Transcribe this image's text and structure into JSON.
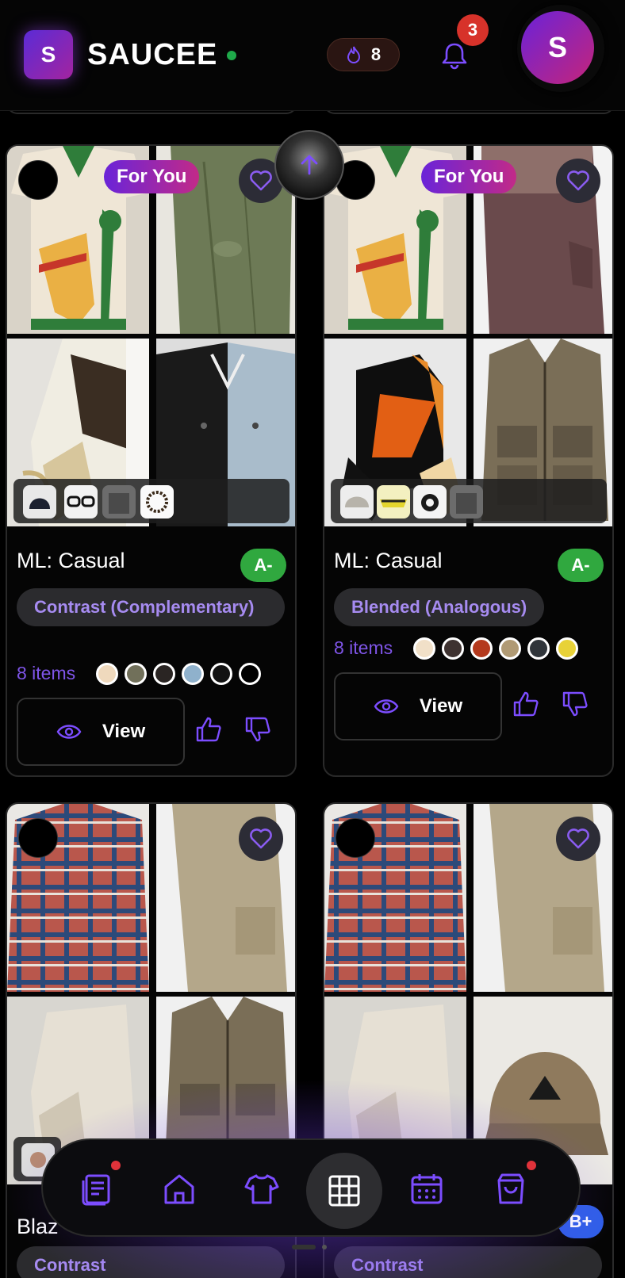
{
  "header": {
    "logo_letter": "S",
    "brand": "SAUCEE",
    "streak_count": "8",
    "notification_count": "3",
    "avatar_letter": "S"
  },
  "cards": [
    {
      "badge": "For You",
      "title": "ML: Casual",
      "grade": "A-",
      "harmony": "Contrast (Complementary)",
      "items": "8 items",
      "swatches": [
        "#efd9bd",
        "#71705a",
        "#2a2523",
        "#8fb1cc",
        "#121212",
        "#000000"
      ],
      "view": "View"
    },
    {
      "badge": "For You",
      "title": "ML: Casual",
      "grade": "A-",
      "harmony": "Blended (Analogous)",
      "items": "8 items",
      "swatches": [
        "#f1e0c8",
        "#3e3230",
        "#b4391d",
        "#b09a74",
        "#30353a",
        "#e8d238"
      ],
      "view": "View"
    },
    {
      "title_partial": "Blaz",
      "harmony": "Contrast"
    },
    {
      "grade": "B+",
      "harmony": "Contrast"
    }
  ],
  "colors": {
    "accent": "#7c4dff",
    "grade_a": "#30a83f",
    "grade_b": "#2f5fe8",
    "badge_gradient_start": "#6a24d8",
    "badge_gradient_end": "#c22a88",
    "notification": "#d7322a"
  },
  "nav": {
    "items": [
      "feed-icon",
      "home-icon",
      "shirt-icon",
      "grid-icon",
      "calendar-icon",
      "shopping-bag-icon"
    ],
    "active": "grid-icon"
  }
}
